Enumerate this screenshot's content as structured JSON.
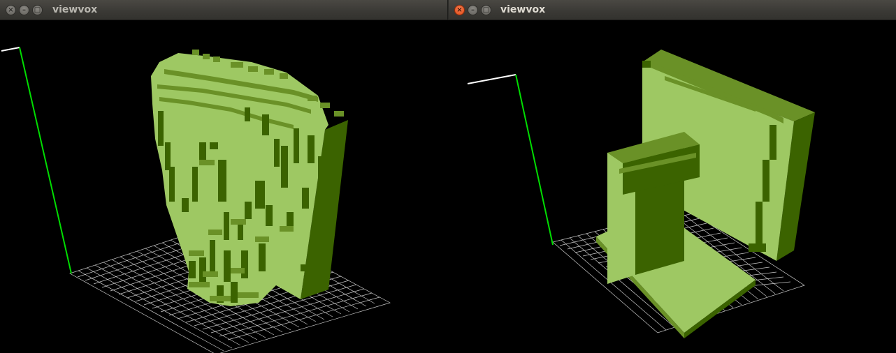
{
  "windows": [
    {
      "title": "viewvox",
      "active": false,
      "controls": {
        "close_icon": "×",
        "minimize_icon": "–",
        "maximize_icon": "□"
      },
      "viewport": "voxel-bust-model"
    },
    {
      "title": "viewvox",
      "active": true,
      "controls": {
        "close_icon": "×",
        "minimize_icon": "–",
        "maximize_icon": "□"
      },
      "viewport": "voxel-monitor-model"
    }
  ],
  "colors": {
    "background": "#000000",
    "voxel_top": "#9ec863",
    "voxel_front": "#6a9127",
    "voxel_side": "#3b6300",
    "grid": "#c8c8c8",
    "axis_green": "#00dd00",
    "axis_white": "#ffffff"
  }
}
